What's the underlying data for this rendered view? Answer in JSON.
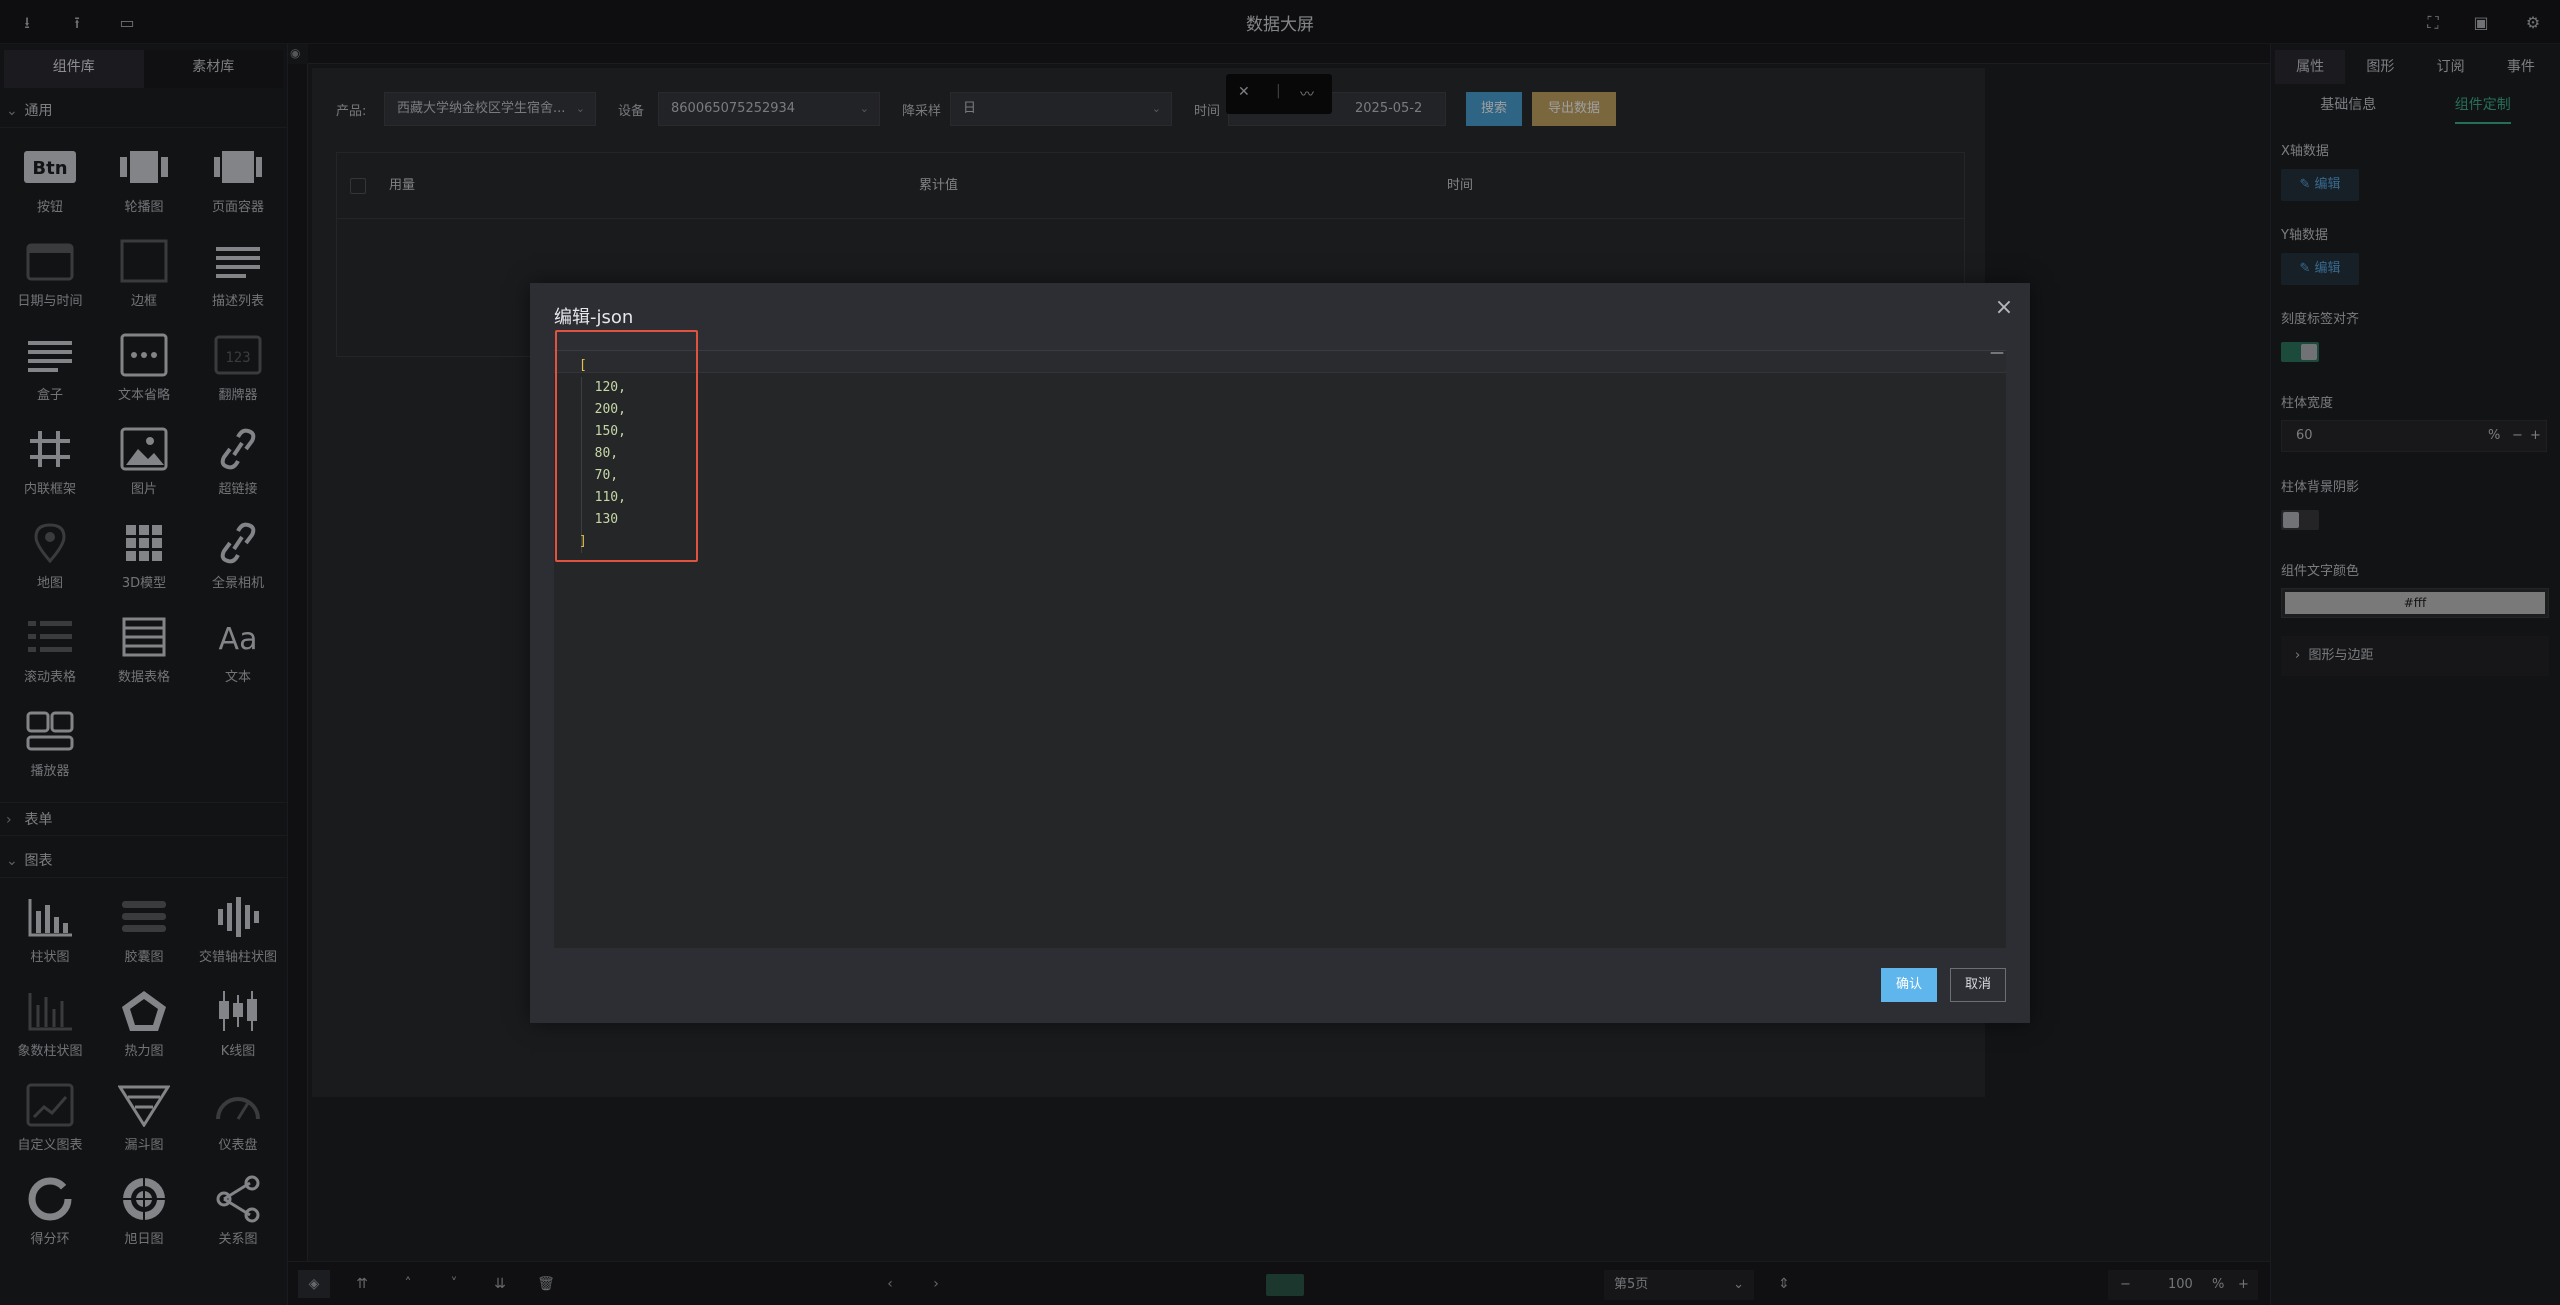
{
  "app": {
    "title": "数据大屏"
  },
  "left_panel": {
    "tabs": [
      "组件库",
      "素材库"
    ],
    "groups": {
      "general": {
        "label": "通用",
        "items": [
          "按钮",
          "轮播图",
          "页面容器",
          "日期与时间",
          "边框",
          "描述列表",
          "盒子",
          "文本省略",
          "翻牌器",
          "内联框架",
          "图片",
          "超链接",
          "地图",
          "3D模型",
          "全景相机",
          "滚动表格",
          "数据表格",
          "文本",
          "播放器"
        ]
      },
      "form": {
        "label": "表单"
      },
      "chart": {
        "label": "图表",
        "items": [
          "柱状图",
          "胶囊图",
          "交错轴柱状图",
          "象数柱状图",
          "热力图",
          "K线图",
          "自定义图表",
          "漏斗图",
          "仪表盘",
          "得分环",
          "旭日图",
          "关系图"
        ]
      }
    }
  },
  "canvas": {
    "product_label": "产品:",
    "product_value": "西藏大学纳金校区学生宿舍...",
    "device_label": "设备",
    "device_value": "860065075252934",
    "sample_label": "降采样",
    "sample_value": "日",
    "time_label": "时间",
    "time_value": "2025-05-2",
    "search_btn": "搜索",
    "export_btn": "导出数据",
    "table_headers": [
      "用量",
      "累计值",
      "时间"
    ]
  },
  "bottom_bar": {
    "page_select": "第5页",
    "zoom": "100",
    "zoom_unit": "%"
  },
  "right_panel": {
    "tabs": [
      "属性",
      "图形",
      "订阅",
      "事件"
    ],
    "sub_tabs": [
      "基础信息",
      "组件定制"
    ],
    "x_data_label": "X轴数据",
    "y_data_label": "Y轴数据",
    "edit_label": "编辑",
    "tick_align_label": "刻度标签对齐",
    "bar_width_label": "柱体宽度",
    "bar_width_value": "60",
    "bar_width_unit": "%",
    "bar_bg_label": "柱体背景阴影",
    "text_color_label": "组件文字颜色",
    "text_color_value": "#fff",
    "shape_margin_label": "图形与边距"
  },
  "modal": {
    "title": "编辑-json",
    "json_values": [
      "120",
      "200",
      "150",
      "80",
      "70",
      "110",
      "130"
    ],
    "confirm": "确认",
    "cancel": "取消"
  }
}
